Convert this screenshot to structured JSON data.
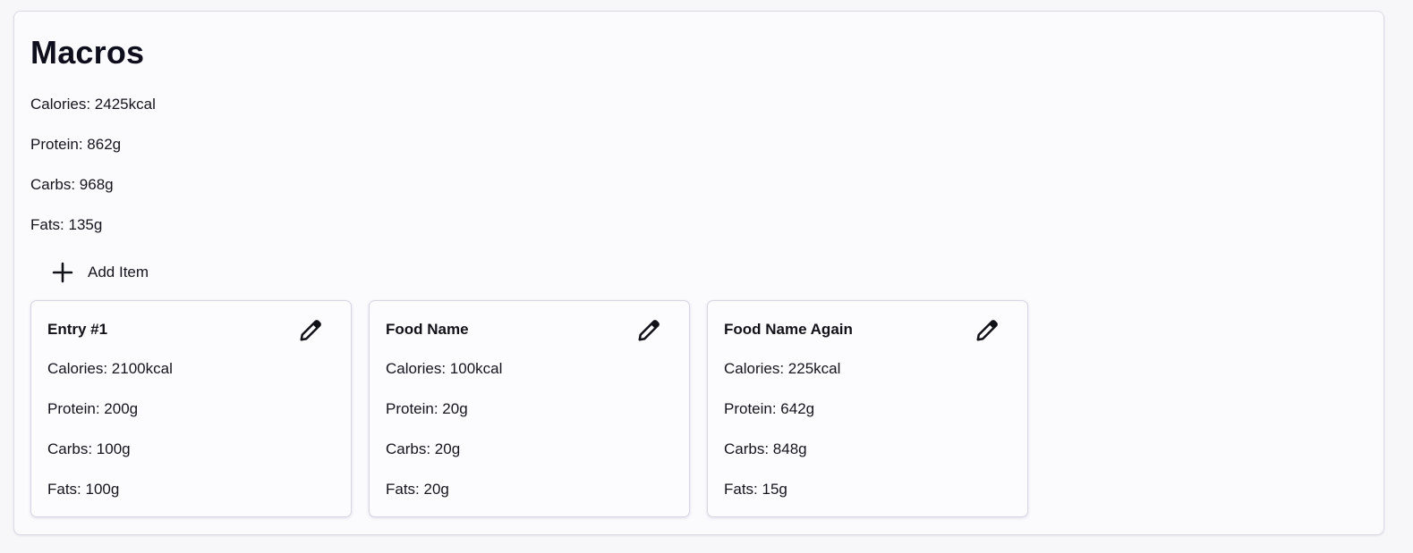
{
  "header": {
    "title": "Macros"
  },
  "summary": {
    "calories": "Calories: 2425kcal",
    "protein": "Protein: 862g",
    "carbs": "Carbs: 968g",
    "fats": "Fats: 135g"
  },
  "add_item": {
    "label": "Add Item",
    "icon": "plus-icon"
  },
  "entries": [
    {
      "name": "Entry #1",
      "calories": "Calories: 2100kcal",
      "protein": "Protein: 200g",
      "carbs": "Carbs: 100g",
      "fats": "Fats: 100g",
      "edit_icon": "pencil-icon"
    },
    {
      "name": "Food Name",
      "calories": "Calories: 100kcal",
      "protein": "Protein: 20g",
      "carbs": "Carbs: 20g",
      "fats": "Fats: 20g",
      "edit_icon": "pencil-icon"
    },
    {
      "name": "Food Name Again",
      "calories": "Calories: 225kcal",
      "protein": "Protein: 642g",
      "carbs": "Carbs: 848g",
      "fats": "Fats: 15g",
      "edit_icon": "pencil-icon"
    }
  ],
  "colors": {
    "background": "#f7f7fa",
    "panel": "#fbfbfe",
    "border": "#dcdce6",
    "text": "#14141c"
  }
}
